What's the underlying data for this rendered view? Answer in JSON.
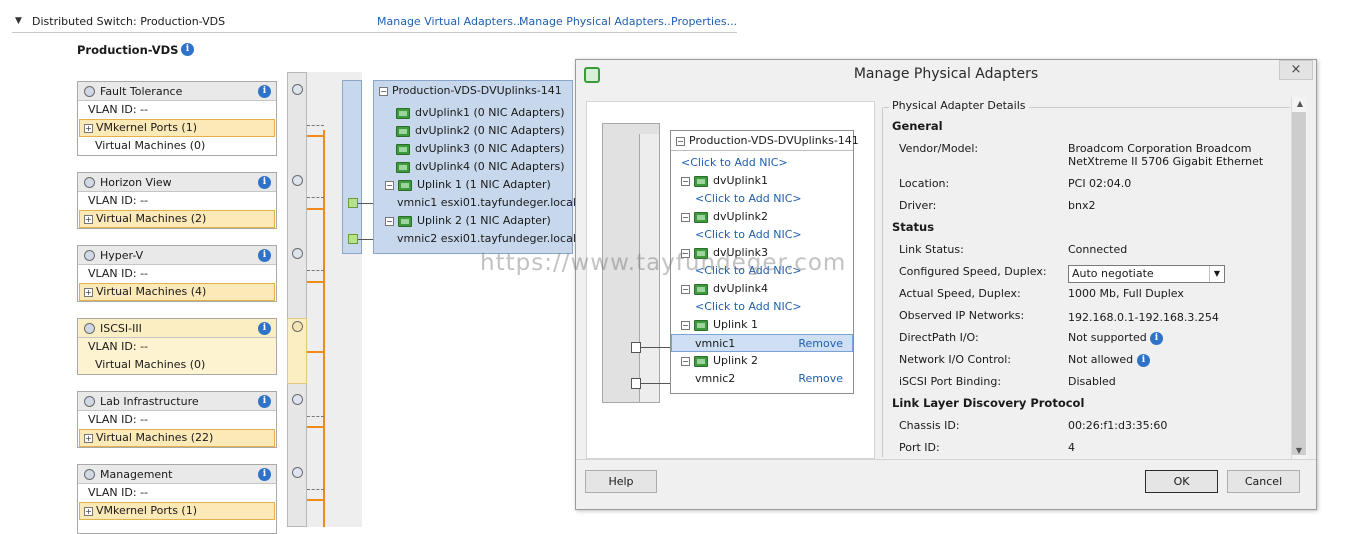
{
  "header": {
    "title": "Distributed Switch: Production-VDS",
    "links": [
      "Manage Virtual Adapters...",
      "Manage Physical Adapters...",
      "Properties..."
    ]
  },
  "switch_name": "Production-VDS",
  "port_groups": [
    {
      "name": "Fault Tolerance",
      "vlan": "VLAN ID: --",
      "item": "VMkernel Ports (1)",
      "expandable": true
    },
    {
      "name": "Horizon View",
      "vlan": "VLAN ID: --",
      "item": "Virtual Machines (2)",
      "expandable": true
    },
    {
      "name": "Hyper-V",
      "vlan": "VLAN ID: --",
      "item": "Virtual Machines (4)",
      "expandable": true
    },
    {
      "name": "ISCSI-III",
      "vlan": "VLAN ID: --",
      "item": "Virtual Machines (0)",
      "expandable": false
    },
    {
      "name": "Lab Infrastructure",
      "vlan": "VLAN ID: --",
      "item": "Virtual Machines (22)",
      "expandable": true
    },
    {
      "name": "Management",
      "vlan": "VLAN ID: --",
      "item": "VMkernel Ports (1)",
      "expandable": true
    }
  ],
  "fault_tolerance_vms": "Virtual Machines (0)",
  "uplink_group": {
    "title": "Production-VDS-DVUplinks-141",
    "rows": [
      "dvUplink1 (0 NIC Adapters)",
      "dvUplink2 (0 NIC Adapters)",
      "dvUplink3 (0 NIC Adapters)",
      "dvUplink4 (0 NIC Adapters)",
      "Uplink 1 (1 NIC Adapter)",
      "vmnic1 esxi01.tayfundeger.local",
      "Uplink 2 (1 NIC Adapter)",
      "vmnic2 esxi01.tayfundeger.local"
    ]
  },
  "dialog": {
    "title": "Manage Physical Adapters",
    "close": "×",
    "tree": {
      "title": "Production-VDS-DVUplinks-141",
      "add_nic": "<Click to Add NIC>",
      "uplinks": [
        "dvUplink1",
        "dvUplink2",
        "dvUplink3",
        "dvUplink4",
        "Uplink 1",
        "Uplink 2"
      ],
      "nics": [
        "vmnic1",
        "vmnic2"
      ],
      "remove": "Remove"
    },
    "details": {
      "group_title": "Physical Adapter Details",
      "general": "General",
      "vendor_label": "Vendor/Model:",
      "vendor_value_1": "Broadcom Corporation Broadcom",
      "vendor_value_2": "NetXtreme II 5706 Gigabit Ethernet",
      "location_label": "Location:",
      "location_value": "PCI 02:04.0",
      "driver_label": "Driver:",
      "driver_value": "bnx2",
      "status": "Status",
      "link_status_label": "Link Status:",
      "link_status_value": "Connected",
      "configured_speed_label": "Configured Speed, Duplex:",
      "configured_speed_value": "Auto negotiate",
      "actual_speed_label": "Actual Speed, Duplex:",
      "actual_speed_value": "1000 Mb, Full Duplex",
      "observed_ip_label": "Observed IP Networks:",
      "observed_ip_value": "192.168.0.1-192.168.3.254",
      "directpath_label": "DirectPath I/O:",
      "directpath_value": "Not supported",
      "network_io_label": "Network I/O Control:",
      "network_io_value": "Not allowed",
      "iscsi_label": "iSCSI Port Binding:",
      "iscsi_value": "Disabled",
      "lldp": "Link Layer Discovery Protocol",
      "chassis_label": "Chassis ID:",
      "chassis_value": "00:26:f1:d3:35:60",
      "port_label": "Port ID:",
      "port_value": "4"
    },
    "buttons": {
      "help": "Help",
      "ok": "OK",
      "cancel": "Cancel"
    }
  },
  "watermark": "https://www.tayfundeger.com",
  "colors": {
    "accent": "#f08a1c",
    "link": "#1f5fb0",
    "selection": "#cfe0f5",
    "highlight": "#fbe9b7"
  }
}
